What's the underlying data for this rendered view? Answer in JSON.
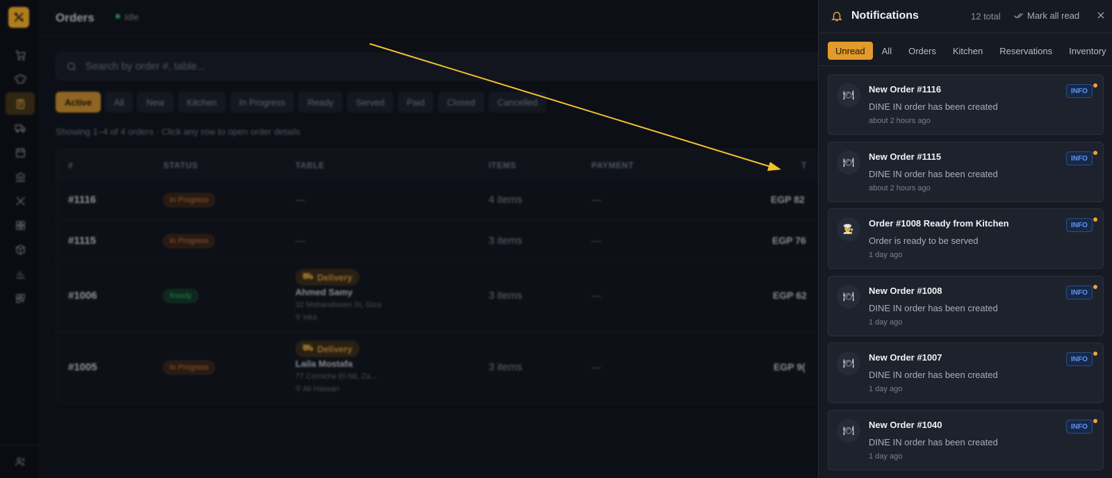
{
  "sidebar": {
    "icons": [
      "cart-icon",
      "chef-hat-icon",
      "clipboard-icon",
      "truck-icon",
      "calendar-icon",
      "bank-icon",
      "utensils-icon",
      "grid-icon",
      "box-icon",
      "bar-chart-icon",
      "layout-icon"
    ],
    "active_index": 2,
    "bottom_icon": "users-icon"
  },
  "header": {
    "title": "Orders",
    "status": "Idle"
  },
  "search": {
    "placeholder": "Search by order #, table..."
  },
  "filters": [
    "Active",
    "All",
    "New",
    "Kitchen",
    "In Progress",
    "Ready",
    "Served",
    "Paid",
    "Closed",
    "Cancelled"
  ],
  "active_filter": "Active",
  "showing_text": "Showing 1–4 of 4 orders · Click any row to open order details",
  "table": {
    "columns": [
      "#",
      "STATUS",
      "TABLE",
      "ITEMS",
      "PAYMENT",
      "T"
    ],
    "rows": [
      {
        "order": "#1116",
        "status": "In Progress",
        "table": "—",
        "items": "4 items",
        "payment": "—",
        "total": "EGP 82"
      },
      {
        "order": "#1115",
        "status": "In Progress",
        "table": "—",
        "items": "3 items",
        "payment": "—",
        "total": "EGP 76"
      },
      {
        "order": "#1006",
        "status": "Ready",
        "delivery": "Delivery",
        "customer": "Ahmed Samy",
        "address": "32 Mohandiseen St, Giza",
        "agent": "loka",
        "items": "3 items",
        "payment": "—",
        "total": "EGP 62"
      },
      {
        "order": "#1005",
        "status": "In Progress",
        "delivery": "Delivery",
        "customer": "Laila Mostafa",
        "address": "77 Corniche El-Nil, Za...",
        "agent": "Ali Hassan",
        "items": "3 items",
        "payment": "—",
        "total": "EGP 9("
      }
    ]
  },
  "notifications_panel": {
    "title": "Notifications",
    "total": "12 total",
    "mark_all_read": "Mark all read",
    "tabs": [
      "Unread",
      "All",
      "Orders",
      "Kitchen",
      "Reservations",
      "Inventory"
    ],
    "active_tab": "Unread",
    "items": [
      {
        "title": "New Order #1116",
        "body": "DINE IN order has been created",
        "time": "about 2 hours ago",
        "badge": "INFO",
        "icon": "plate-icon"
      },
      {
        "title": "New Order #1115",
        "body": "DINE IN order has been created",
        "time": "about 2 hours ago",
        "badge": "INFO",
        "icon": "plate-icon"
      },
      {
        "title": "Order #1008 Ready from Kitchen",
        "body": "Order is ready to be served",
        "time": "1 day ago",
        "badge": "INFO",
        "icon": "chef-icon"
      },
      {
        "title": "New Order #1008",
        "body": "DINE IN order has been created",
        "time": "1 day ago",
        "badge": "INFO",
        "icon": "plate-icon"
      },
      {
        "title": "New Order #1007",
        "body": "DINE IN order has been created",
        "time": "1 day ago",
        "badge": "INFO",
        "icon": "plate-icon"
      },
      {
        "title": "New Order #1040",
        "body": "DINE IN order has been created",
        "time": "1 day ago",
        "badge": "INFO",
        "icon": "plate-icon"
      }
    ]
  },
  "colors": {
    "accent": "#e29a2b",
    "info": "#5f97f0",
    "annotation_arrow": "#f2c12e"
  }
}
